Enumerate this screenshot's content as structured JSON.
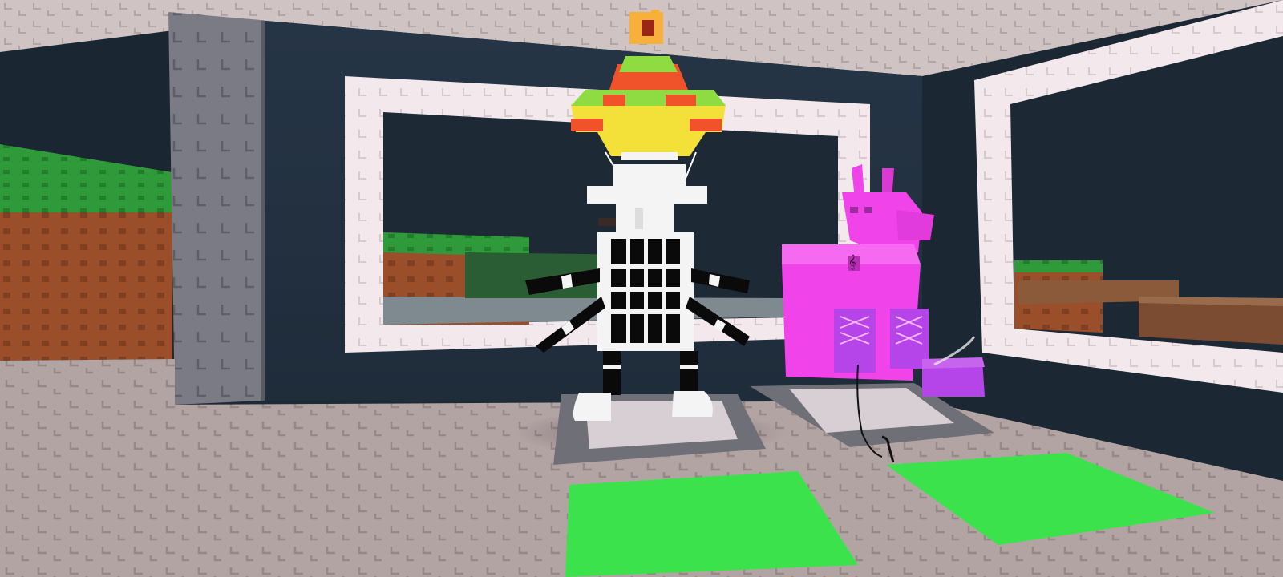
{
  "scene": {
    "description_free": true,
    "colors": {
      "floor": "#b3a4a4",
      "floor_shadow": "#8f8282",
      "ceiling": "#cfc3c3",
      "wall_navy": "#233242",
      "wall_dark": "#18222c",
      "pillar_gray": "#7b7b86",
      "frame_white": "#f3e9ec",
      "grass": "#2f9a3a",
      "dirt": "#9a4e2a",
      "pedestal_gray": "#6f6f77",
      "pedestal_light": "#d7cfd3",
      "pad_green": "#3ce24c",
      "skeleton_black": "#0a0a0a",
      "skeleton_white": "#f4f4f4",
      "sombrero_yellow": "#f3e13a",
      "sombrero_green": "#8fdc42",
      "sombrero_red": "#f0532a",
      "sombrero_crown": "#f7b03a",
      "llama_pink": "#f044ea",
      "llama_purple": "#b545e8"
    },
    "characters": [
      {
        "name": "skeleton-avatar",
        "accessories": [
          "sombrero-hat",
          "white-cap",
          "white-shoes"
        ]
      },
      {
        "name": "pink-llama-avatar",
        "accessories": [
          "purple-boots",
          "music-note"
        ]
      }
    ],
    "pads": [
      {
        "name": "green-pad-left"
      },
      {
        "name": "green-pad-right"
      }
    ]
  }
}
